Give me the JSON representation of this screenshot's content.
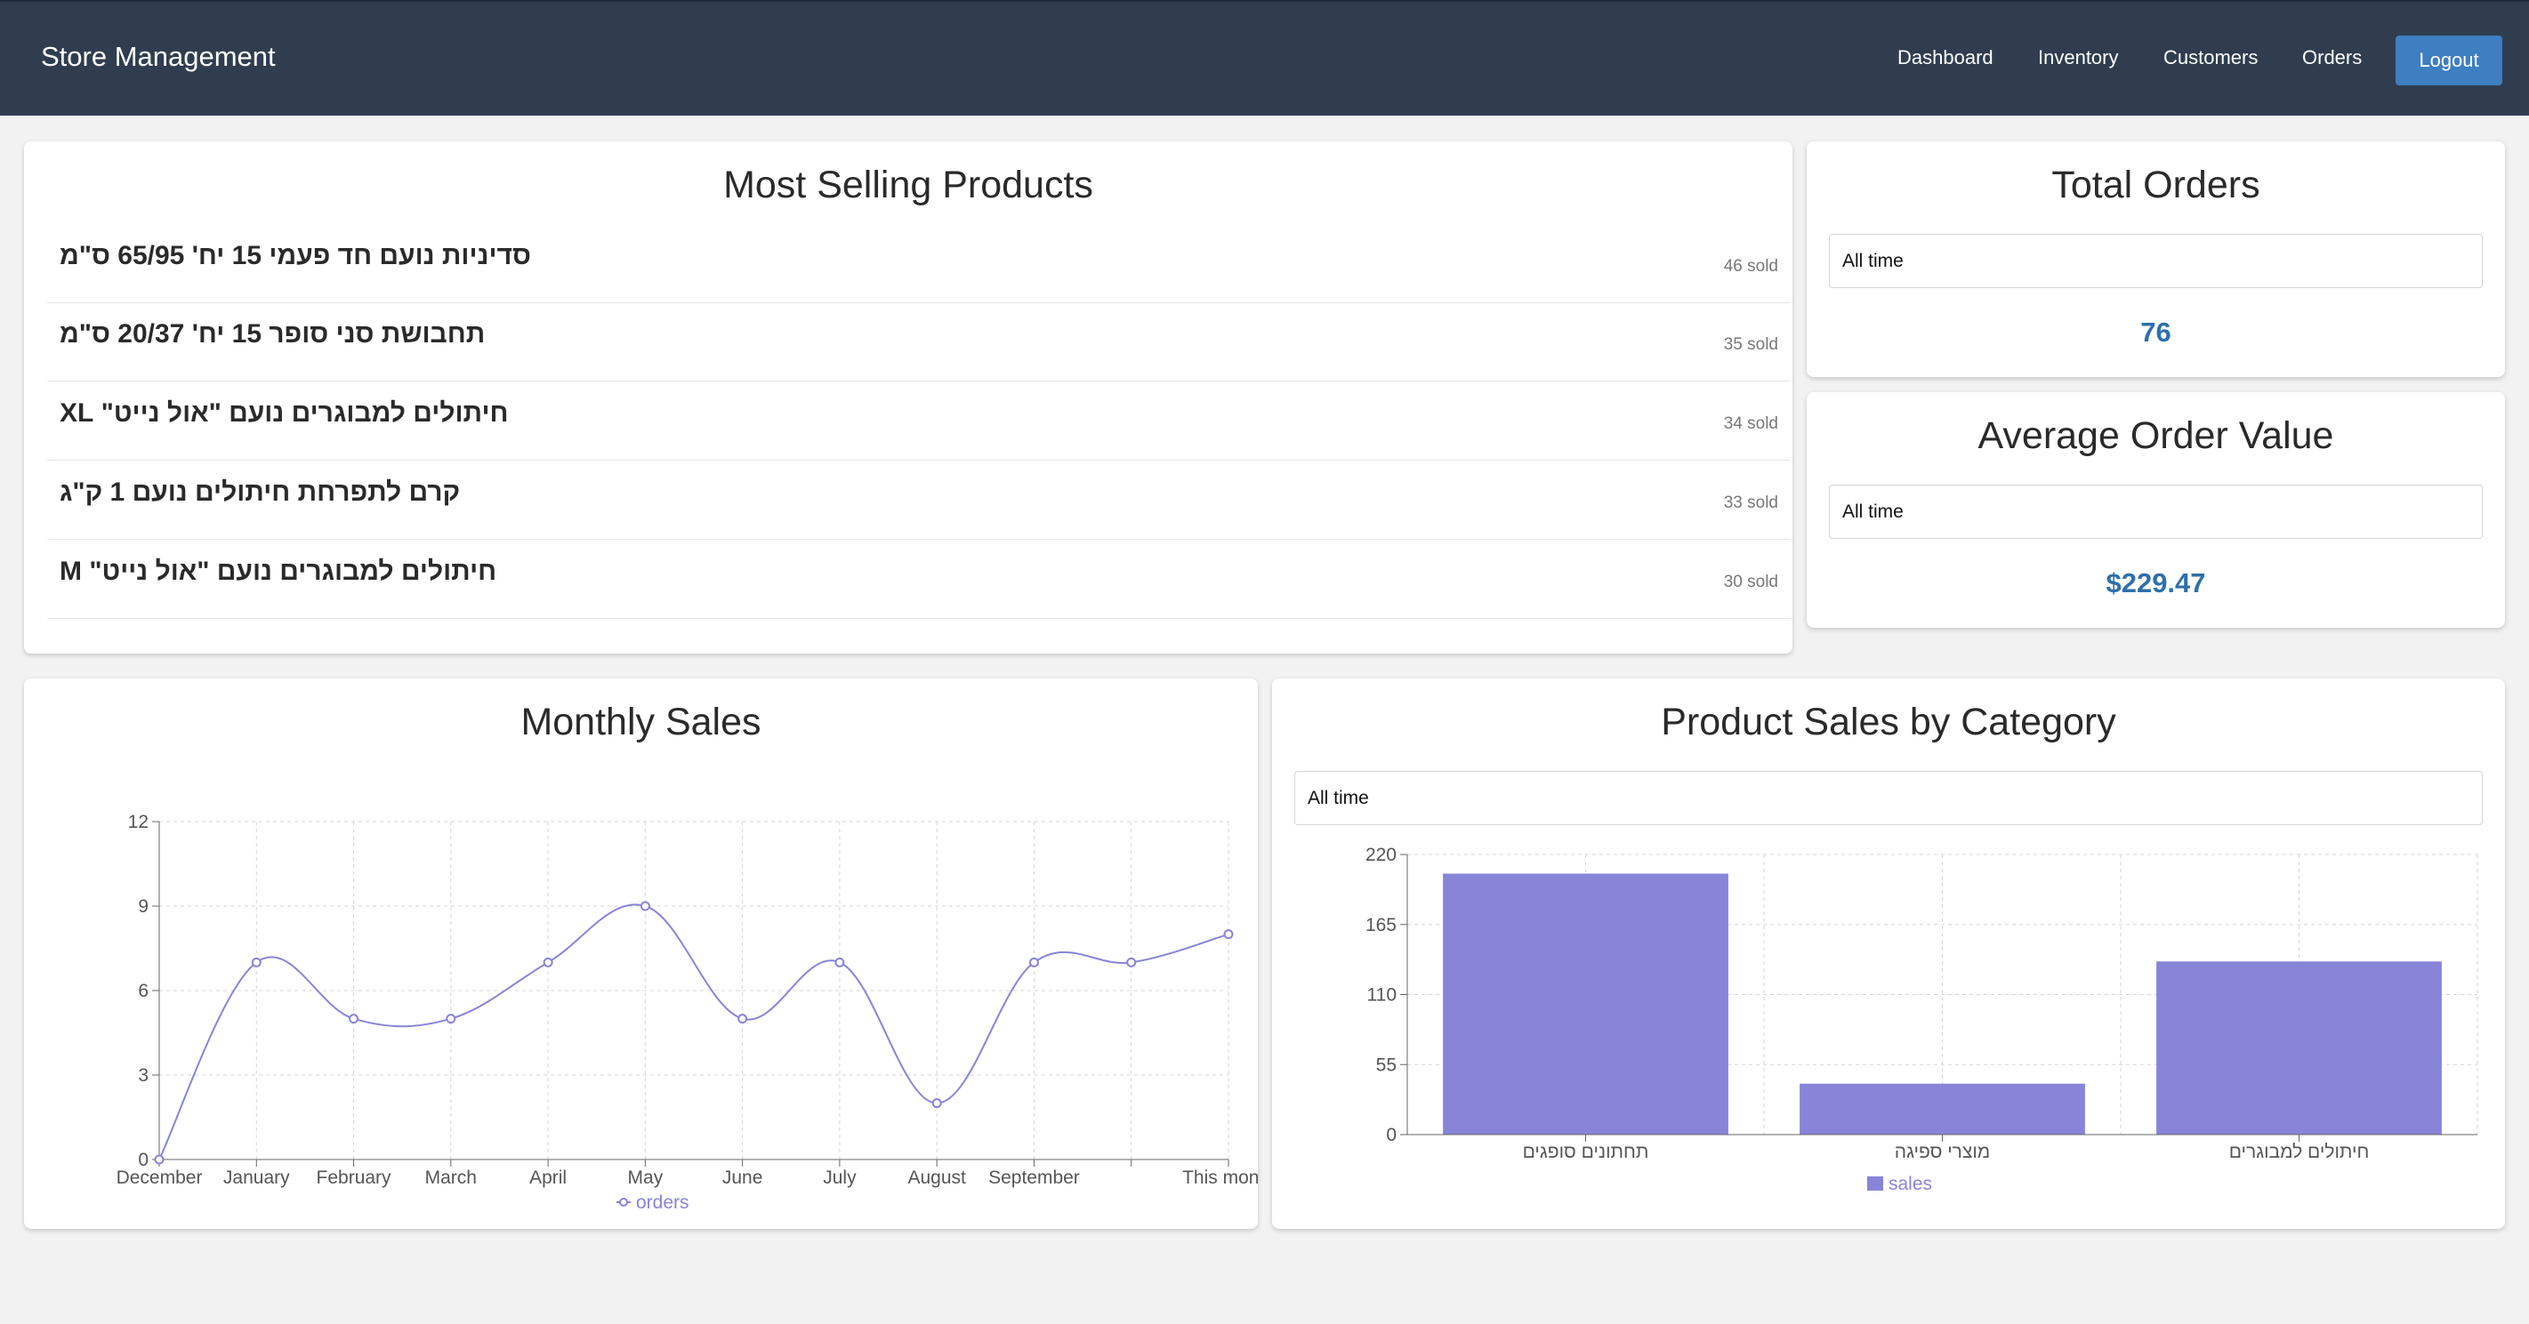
{
  "navbar": {
    "brand": "Store Management",
    "links": [
      "Dashboard",
      "Inventory",
      "Customers",
      "Orders"
    ],
    "logout_label": "Logout"
  },
  "most_selling": {
    "title": "Most Selling Products",
    "items": [
      {
        "name": "סדיניות נועם חד פעמי 15 יח' 65/95 ס\"מ",
        "sold": "46 sold"
      },
      {
        "name": "תחבושת סני סופר 15 יח' 20/37 ס\"מ",
        "sold": "35 sold"
      },
      {
        "name": "חיתולים למבוגרים נועם \"אול נייט\" XL",
        "sold": "34 sold"
      },
      {
        "name": "קרם לתפרחת חיתולים נועם 1 ק\"ג",
        "sold": "33 sold"
      },
      {
        "name": "חיתולים למבוגרים נועם \"אול נייט\" M",
        "sold": "30 sold"
      }
    ]
  },
  "total_orders": {
    "title": "Total Orders",
    "filter": "All time",
    "value": "76"
  },
  "avg_order": {
    "title": "Average Order Value",
    "filter": "All time",
    "value": "$229.47"
  },
  "monthly_sales": {
    "title": "Monthly Sales"
  },
  "category_sales": {
    "title": "Product Sales by Category",
    "filter": "All time"
  },
  "colors": {
    "series": "#8884d8",
    "accent": "#2e6fab",
    "navbar": "#2f3d4f",
    "button": "#3d7fc1"
  },
  "chart_data": [
    {
      "type": "line",
      "title": "Monthly Sales",
      "categories": [
        "December",
        "January",
        "February",
        "March",
        "April",
        "May",
        "June",
        "July",
        "August",
        "September",
        "",
        "This month"
      ],
      "series": [
        {
          "name": "orders",
          "values": [
            0,
            7,
            5,
            5,
            7,
            9,
            5,
            7,
            2,
            7,
            7,
            8
          ]
        }
      ],
      "ylim": [
        0,
        12
      ],
      "yticks": [
        0,
        3,
        6,
        9,
        12
      ],
      "grid": true,
      "legend": "bottom"
    },
    {
      "type": "bar",
      "title": "Product Sales by Category",
      "categories": [
        "תחתונים סופגים",
        "מוצרי ספיגה",
        "חיתולים למבוגרים"
      ],
      "series": [
        {
          "name": "sales",
          "values": [
            205,
            40,
            136
          ]
        }
      ],
      "ylim": [
        0,
        220
      ],
      "yticks": [
        0,
        55,
        110,
        165,
        220
      ],
      "grid": true,
      "legend": "bottom"
    }
  ]
}
